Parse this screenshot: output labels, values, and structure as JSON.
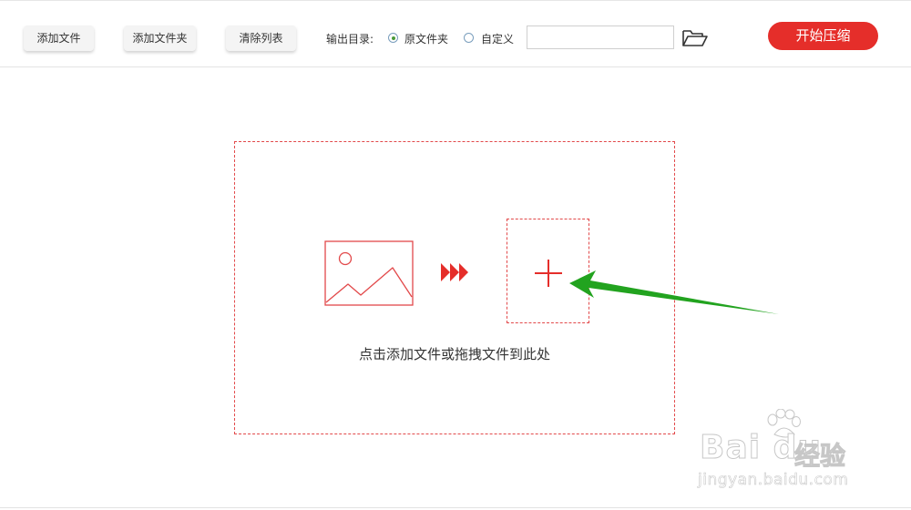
{
  "toolbar": {
    "add_file_label": "添加文件",
    "add_folder_label": "添加文件夹",
    "clear_list_label": "清除列表",
    "output_dir_label": "输出目录:",
    "radio_original_label": "原文件夹",
    "radio_custom_label": "自定义",
    "selected_output": "原文件夹",
    "path_value": "",
    "path_placeholder": "",
    "folder_icon": "folder-open-icon",
    "start_label": "开始压缩"
  },
  "drop_zone": {
    "hint": "点击添加文件或拖拽文件到此处",
    "image_icon": "image-icon",
    "arrows_icon": "triple-arrow-icon",
    "add_icon": "plus-icon"
  },
  "annotation": {
    "arrow": "green-pointer-arrow"
  },
  "watermark": {
    "brand": "Bai du",
    "cn": "经验",
    "url": "jingyan.baidu.com"
  },
  "colors": {
    "accent": "#e52e2a",
    "dashed_border": "#e2494a",
    "radio_dot": "#4a9a3a",
    "annotation_arrow": "#22a31f"
  }
}
